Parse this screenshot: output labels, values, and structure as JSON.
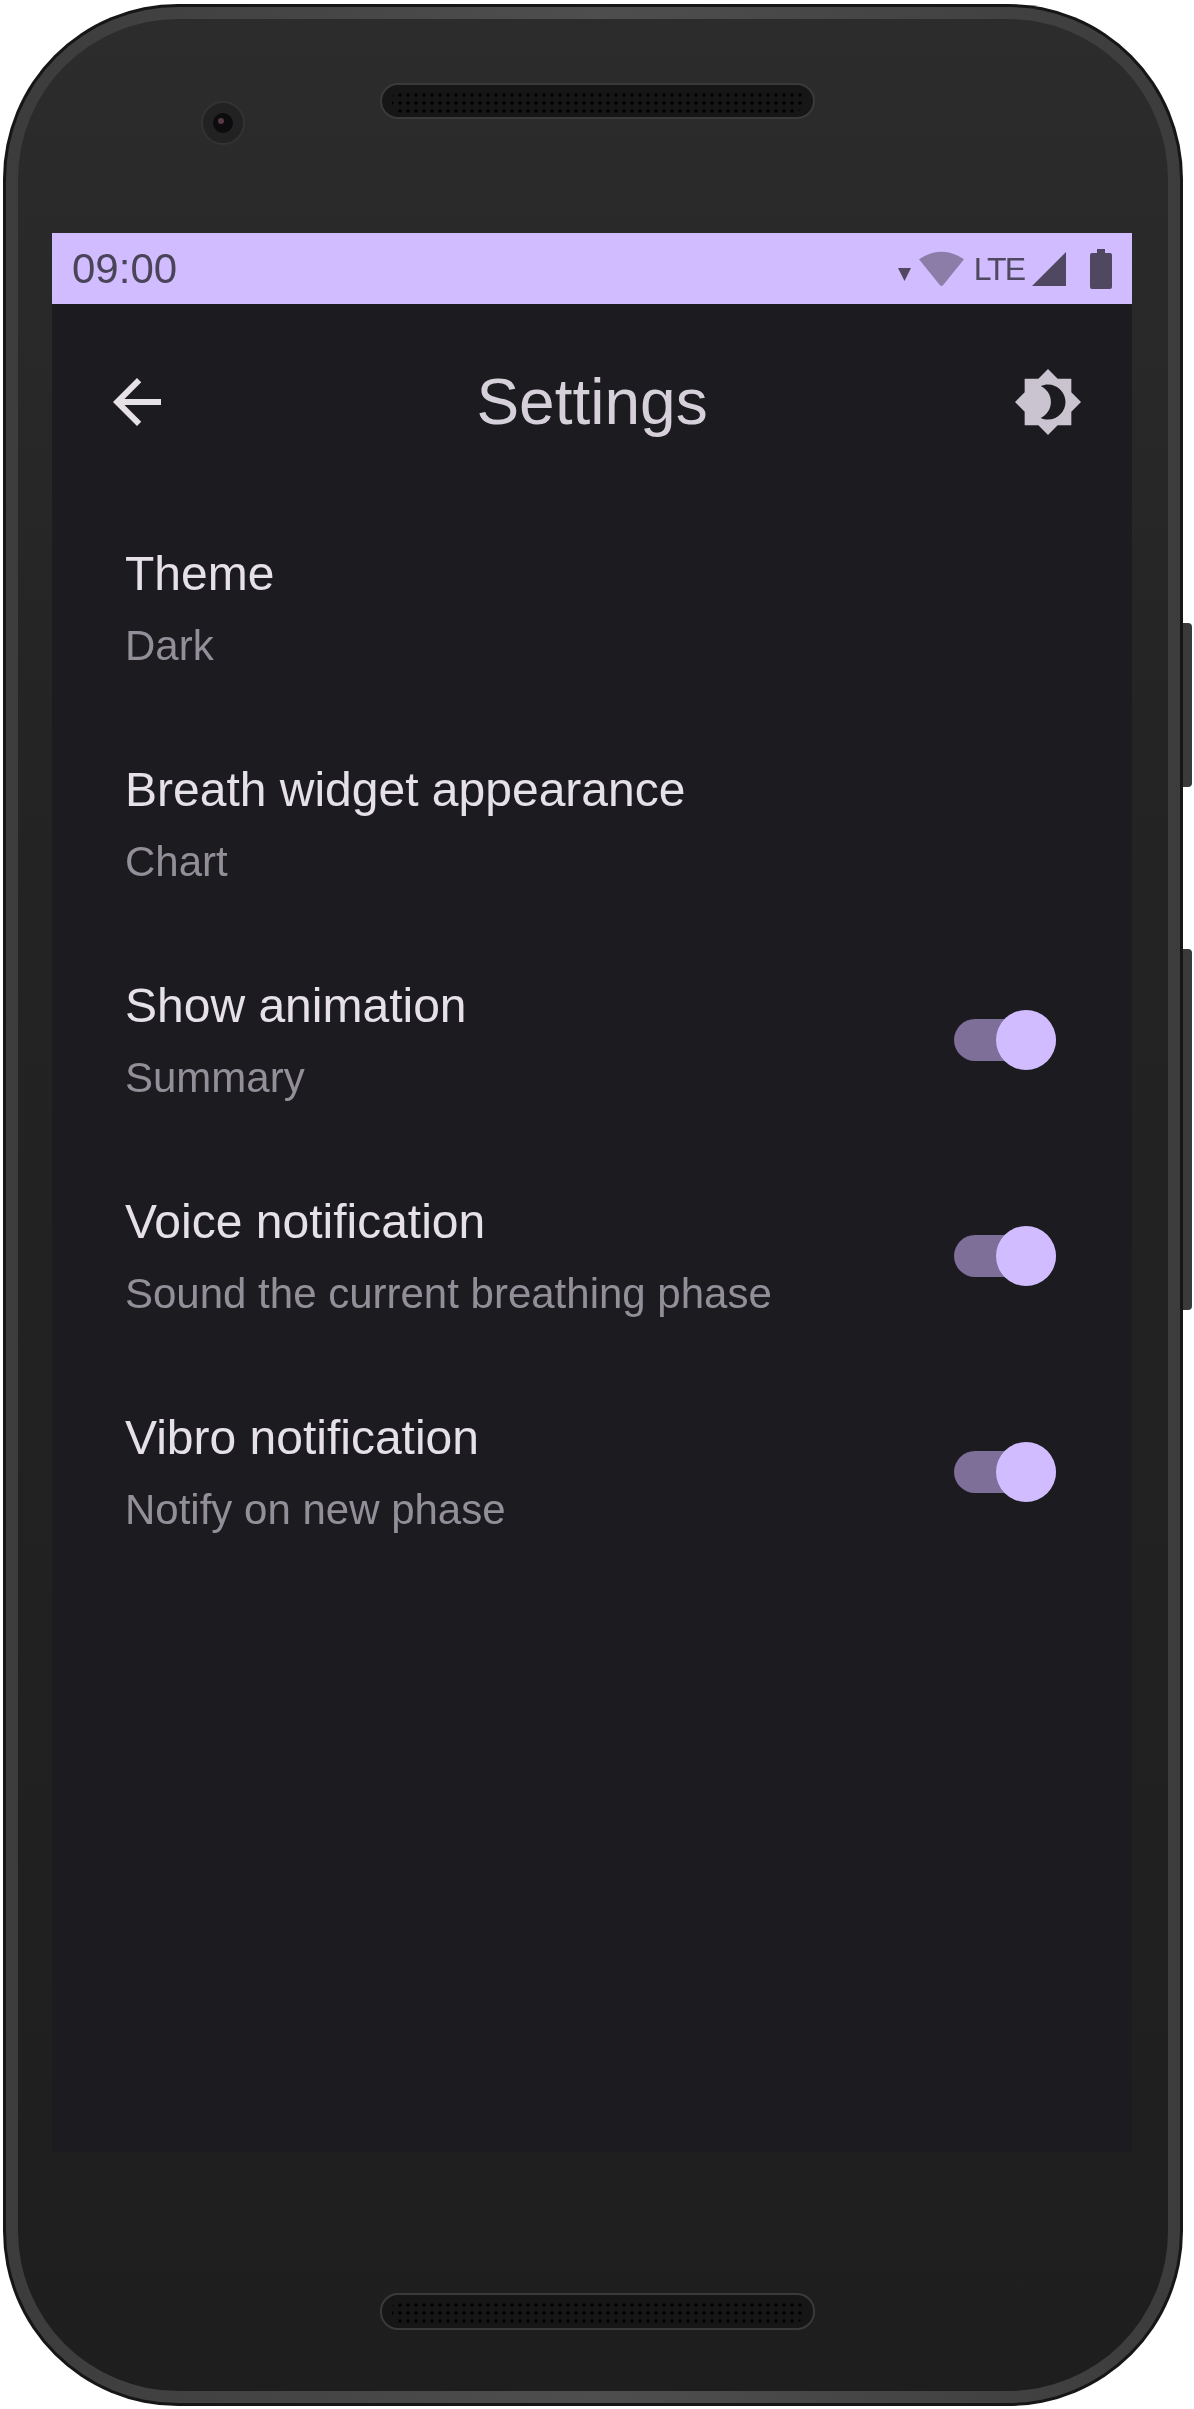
{
  "status_bar": {
    "time": "09:00",
    "network": "LTE"
  },
  "app_bar": {
    "title": "Settings"
  },
  "preferences": [
    {
      "kind": "value",
      "title": "Theme",
      "summary": "Dark"
    },
    {
      "kind": "value",
      "title": "Breath widget appearance",
      "summary": "Chart"
    },
    {
      "kind": "switch",
      "title": "Show animation",
      "summary": "Summary",
      "on": true
    },
    {
      "kind": "switch",
      "title": "Voice notification",
      "summary": "Sound the current breathing phase",
      "on": true
    },
    {
      "kind": "switch",
      "title": "Vibro notification",
      "summary": "Notify on new phase",
      "on": true
    }
  ]
}
